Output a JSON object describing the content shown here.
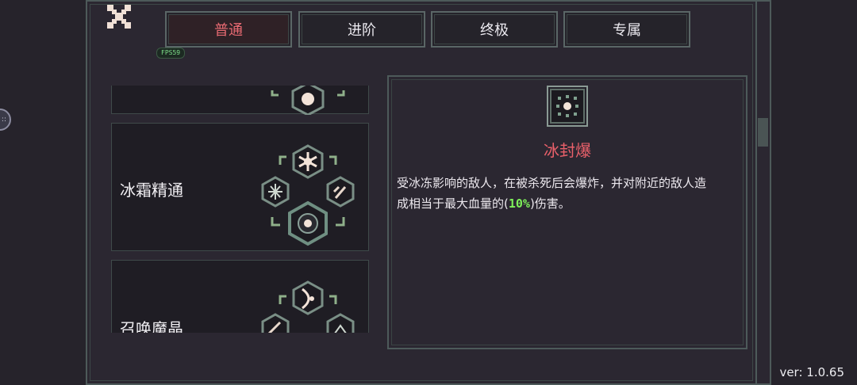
{
  "tabs": [
    {
      "label": "普通",
      "active": true
    },
    {
      "label": "进阶",
      "active": false
    },
    {
      "label": "终极",
      "active": false
    },
    {
      "label": "专属",
      "active": false
    }
  ],
  "fps_label": "FPS59",
  "skills": [
    {
      "name": ""
    },
    {
      "name": "冰霜精通"
    },
    {
      "name": "召唤魔晶"
    }
  ],
  "detail": {
    "title": "冰封爆",
    "desc_line1": "受冰冻影响的敌人，在被杀死后会爆炸，并对附近的敌人造",
    "desc_line2_pre": "成相当于最大血量的(",
    "desc_value": "10%",
    "desc_line2_post": ")伤害。"
  },
  "version": "ver: 1.0.65",
  "colors": {
    "accent_red": "#e8606a",
    "highlight_green": "#7ef05a",
    "panel_border": "#4d5a5a",
    "background": "#26232b"
  },
  "icons": {
    "close": "close-x-icon",
    "frost_nova": "snowflake-icon",
    "ice_burst": "ice-explosion-icon"
  }
}
